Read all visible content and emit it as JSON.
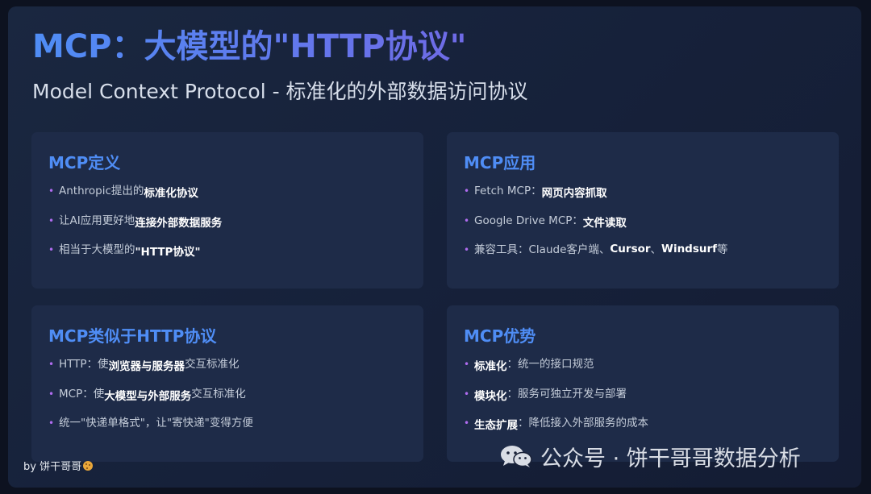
{
  "title": "MCP：大模型的\"HTTP协议\"",
  "subtitle": "Model Context Protocol - 标准化的外部数据访问协议",
  "cards": [
    {
      "heading": "MCP定义",
      "items": [
        {
          "pre": "Anthropic提出的",
          "bold": "标准化协议",
          "post": ""
        },
        {
          "pre": "让AI应用更好地",
          "bold": "连接外部数据服务",
          "post": ""
        },
        {
          "pre": "相当于大模型的",
          "bold": "\"HTTP协议\"",
          "post": ""
        }
      ]
    },
    {
      "heading": "MCP应用",
      "items": [
        {
          "pre": "Fetch MCP：",
          "bold": "网页内容抓取",
          "post": ""
        },
        {
          "pre": "Google Drive MCP：",
          "bold": "文件读取",
          "post": ""
        },
        {
          "pre": "兼容工具：Claude客户端、",
          "bold": "Cursor",
          "mid": "、",
          "bold2": "Windsurf",
          "post": "等"
        }
      ]
    },
    {
      "heading": "MCP类似于HTTP协议",
      "items": [
        {
          "pre": "HTTP：使",
          "bold": "浏览器与服务器",
          "post": "交互标准化"
        },
        {
          "pre": "MCP：使",
          "bold": "大模型与外部服务",
          "post": "交互标准化"
        },
        {
          "pre": "统一\"快递单格式\"，让\"寄快递\"变得方便",
          "bold": "",
          "post": ""
        }
      ]
    },
    {
      "heading": "MCP优势",
      "items": [
        {
          "pre": "",
          "bold": "标准化",
          "post": "：统一的接口规范"
        },
        {
          "pre": "",
          "bold": "模块化",
          "post": "：服务可独立开发与部署"
        },
        {
          "pre": "",
          "bold": "生态扩展",
          "post": "：降低接入外部服务的成本"
        }
      ]
    }
  ],
  "byline": "by 饼干哥哥",
  "watermark": "公众号 · 饼干哥哥数据分析",
  "colors": {
    "accent": "#4f8df5",
    "bullet": "#b06cf0",
    "card_bg": "#1e2b48"
  }
}
